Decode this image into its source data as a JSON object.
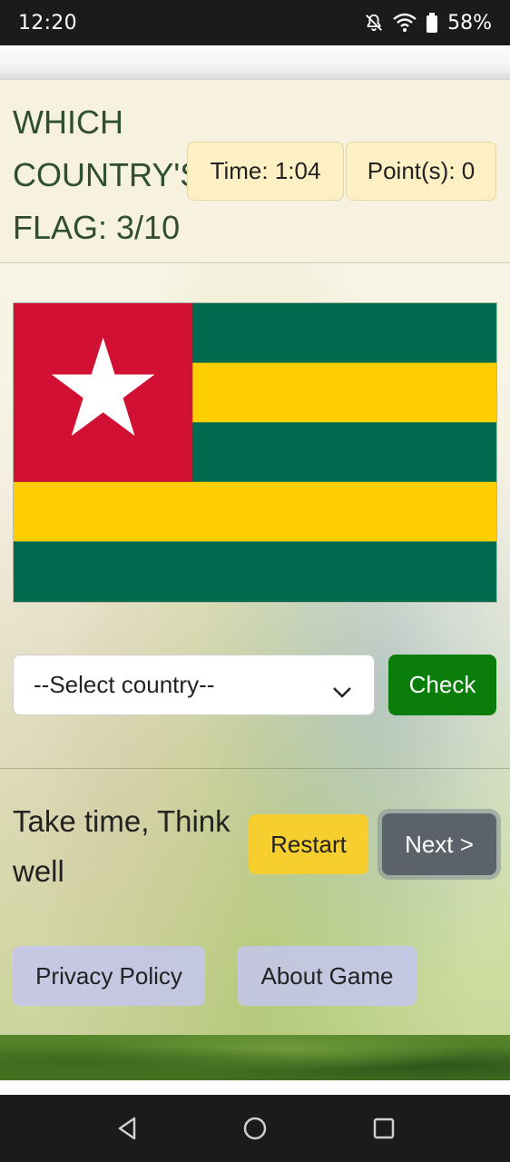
{
  "status_bar": {
    "time": "12:20",
    "battery": "58%",
    "icons": [
      "mute-bell-icon",
      "wifi-icon",
      "battery-icon"
    ]
  },
  "game": {
    "title": "WHICH COUNTRY'S FLAG: 3/10",
    "timer": "Time: 1:04",
    "points": "Point(s): 0",
    "flag_country": "Togo"
  },
  "answer": {
    "select_value": "--Select country--",
    "check_label": "Check"
  },
  "footer_row": {
    "tagline": "Take time, Think well",
    "restart_label": "Restart",
    "next_label": "Next >"
  },
  "links": {
    "privacy_label": "Privacy Policy",
    "about_label": "About Game"
  },
  "colors": {
    "check_green": "#0a7d0a",
    "restart_yellow": "#f6cf2f",
    "next_gray": "#5b6269",
    "flag_green": "#006a4e",
    "flag_yellow": "#ffce00",
    "flag_red": "#d21034"
  },
  "navigation_bar": {
    "icons": [
      "back-icon",
      "home-icon",
      "recents-icon"
    ]
  }
}
